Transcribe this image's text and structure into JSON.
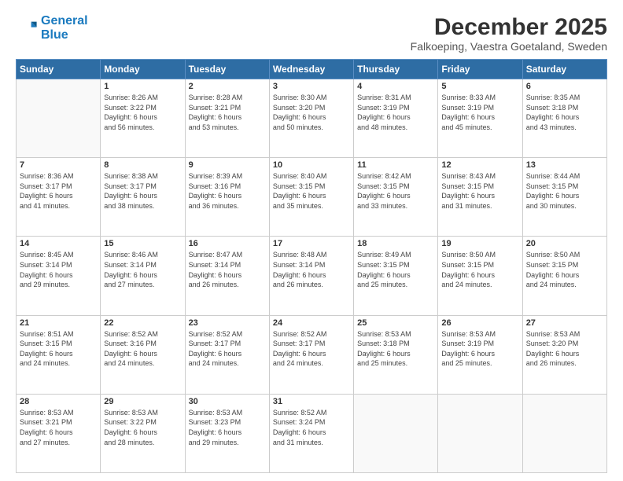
{
  "logo": {
    "line1": "General",
    "line2": "Blue"
  },
  "title": "December 2025",
  "subtitle": "Falkoeping, Vaestra Goetaland, Sweden",
  "days_of_week": [
    "Sunday",
    "Monday",
    "Tuesday",
    "Wednesday",
    "Thursday",
    "Friday",
    "Saturday"
  ],
  "weeks": [
    [
      {
        "day": "",
        "info": ""
      },
      {
        "day": "1",
        "info": "Sunrise: 8:26 AM\nSunset: 3:22 PM\nDaylight: 6 hours\nand 56 minutes."
      },
      {
        "day": "2",
        "info": "Sunrise: 8:28 AM\nSunset: 3:21 PM\nDaylight: 6 hours\nand 53 minutes."
      },
      {
        "day": "3",
        "info": "Sunrise: 8:30 AM\nSunset: 3:20 PM\nDaylight: 6 hours\nand 50 minutes."
      },
      {
        "day": "4",
        "info": "Sunrise: 8:31 AM\nSunset: 3:19 PM\nDaylight: 6 hours\nand 48 minutes."
      },
      {
        "day": "5",
        "info": "Sunrise: 8:33 AM\nSunset: 3:19 PM\nDaylight: 6 hours\nand 45 minutes."
      },
      {
        "day": "6",
        "info": "Sunrise: 8:35 AM\nSunset: 3:18 PM\nDaylight: 6 hours\nand 43 minutes."
      }
    ],
    [
      {
        "day": "7",
        "info": "Sunrise: 8:36 AM\nSunset: 3:17 PM\nDaylight: 6 hours\nand 41 minutes."
      },
      {
        "day": "8",
        "info": "Sunrise: 8:38 AM\nSunset: 3:17 PM\nDaylight: 6 hours\nand 38 minutes."
      },
      {
        "day": "9",
        "info": "Sunrise: 8:39 AM\nSunset: 3:16 PM\nDaylight: 6 hours\nand 36 minutes."
      },
      {
        "day": "10",
        "info": "Sunrise: 8:40 AM\nSunset: 3:15 PM\nDaylight: 6 hours\nand 35 minutes."
      },
      {
        "day": "11",
        "info": "Sunrise: 8:42 AM\nSunset: 3:15 PM\nDaylight: 6 hours\nand 33 minutes."
      },
      {
        "day": "12",
        "info": "Sunrise: 8:43 AM\nSunset: 3:15 PM\nDaylight: 6 hours\nand 31 minutes."
      },
      {
        "day": "13",
        "info": "Sunrise: 8:44 AM\nSunset: 3:15 PM\nDaylight: 6 hours\nand 30 minutes."
      }
    ],
    [
      {
        "day": "14",
        "info": "Sunrise: 8:45 AM\nSunset: 3:14 PM\nDaylight: 6 hours\nand 29 minutes."
      },
      {
        "day": "15",
        "info": "Sunrise: 8:46 AM\nSunset: 3:14 PM\nDaylight: 6 hours\nand 27 minutes."
      },
      {
        "day": "16",
        "info": "Sunrise: 8:47 AM\nSunset: 3:14 PM\nDaylight: 6 hours\nand 26 minutes."
      },
      {
        "day": "17",
        "info": "Sunrise: 8:48 AM\nSunset: 3:14 PM\nDaylight: 6 hours\nand 26 minutes."
      },
      {
        "day": "18",
        "info": "Sunrise: 8:49 AM\nSunset: 3:15 PM\nDaylight: 6 hours\nand 25 minutes."
      },
      {
        "day": "19",
        "info": "Sunrise: 8:50 AM\nSunset: 3:15 PM\nDaylight: 6 hours\nand 24 minutes."
      },
      {
        "day": "20",
        "info": "Sunrise: 8:50 AM\nSunset: 3:15 PM\nDaylight: 6 hours\nand 24 minutes."
      }
    ],
    [
      {
        "day": "21",
        "info": "Sunrise: 8:51 AM\nSunset: 3:15 PM\nDaylight: 6 hours\nand 24 minutes."
      },
      {
        "day": "22",
        "info": "Sunrise: 8:52 AM\nSunset: 3:16 PM\nDaylight: 6 hours\nand 24 minutes."
      },
      {
        "day": "23",
        "info": "Sunrise: 8:52 AM\nSunset: 3:17 PM\nDaylight: 6 hours\nand 24 minutes."
      },
      {
        "day": "24",
        "info": "Sunrise: 8:52 AM\nSunset: 3:17 PM\nDaylight: 6 hours\nand 24 minutes."
      },
      {
        "day": "25",
        "info": "Sunrise: 8:53 AM\nSunset: 3:18 PM\nDaylight: 6 hours\nand 25 minutes."
      },
      {
        "day": "26",
        "info": "Sunrise: 8:53 AM\nSunset: 3:19 PM\nDaylight: 6 hours\nand 25 minutes."
      },
      {
        "day": "27",
        "info": "Sunrise: 8:53 AM\nSunset: 3:20 PM\nDaylight: 6 hours\nand 26 minutes."
      }
    ],
    [
      {
        "day": "28",
        "info": "Sunrise: 8:53 AM\nSunset: 3:21 PM\nDaylight: 6 hours\nand 27 minutes."
      },
      {
        "day": "29",
        "info": "Sunrise: 8:53 AM\nSunset: 3:22 PM\nDaylight: 6 hours\nand 28 minutes."
      },
      {
        "day": "30",
        "info": "Sunrise: 8:53 AM\nSunset: 3:23 PM\nDaylight: 6 hours\nand 29 minutes."
      },
      {
        "day": "31",
        "info": "Sunrise: 8:52 AM\nSunset: 3:24 PM\nDaylight: 6 hours\nand 31 minutes."
      },
      {
        "day": "",
        "info": ""
      },
      {
        "day": "",
        "info": ""
      },
      {
        "day": "",
        "info": ""
      }
    ]
  ]
}
